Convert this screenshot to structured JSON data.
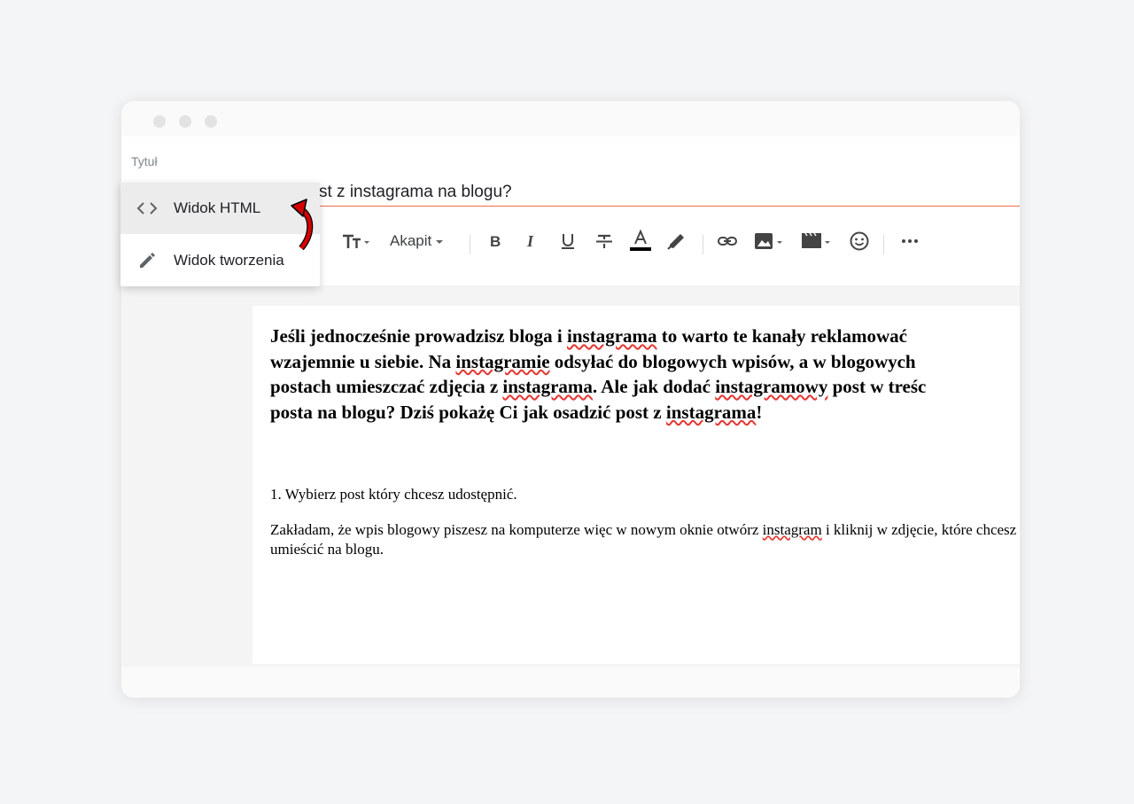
{
  "window": {
    "title_field_label": "Tytuł",
    "title_value": "st z instagrama na blogu?"
  },
  "toolbar": {
    "paragraph_style": "Akapit",
    "buttons": [
      "text-size",
      "paragraph-style",
      "bold",
      "italic",
      "underline",
      "strikethrough",
      "text-color",
      "highlight",
      "link",
      "image",
      "video",
      "emoji",
      "more"
    ]
  },
  "menu": {
    "items": [
      {
        "label": "Widok HTML",
        "icon": "code-icon",
        "active": true
      },
      {
        "label": "Widok tworzenia",
        "icon": "pencil-icon",
        "active": false
      }
    ]
  },
  "document": {
    "intro": {
      "l1a": "Jeśli jednocześnie prowadzisz bloga i ",
      "l1b": "instagrama",
      "l1c": " to warto te kanały reklamować",
      "l2a": "wzajemnie u siebie. Na ",
      "l2b": "instagramie",
      "l2c": " odsyłać do blogowych wpisów, a w blogowych",
      "l3a": "postach umieszczać zdjęcia z ",
      "l3b": "instagrama",
      "l3c": ". Ale jak dodać ",
      "l3d": "instagramowy",
      "l3e": " post w treśc",
      "l4a": "posta na blogu? Dziś pokażę Ci jak osadzić post z ",
      "l4b": "instagrama",
      "l4c": "!"
    },
    "step1": "1. Wybierz post który chcesz udostępnić.",
    "para": {
      "a": "Zakładam, że wpis blogowy piszesz na komputerze więc w nowym oknie otwórz ",
      "b": "instagram",
      "c": " i kliknij w zdjęcie, które chcesz umieścić na blogu."
    }
  },
  "colors": {
    "accent_underline": "#e8704d",
    "arrow": "#d50000",
    "spellcheck": "#e53935"
  }
}
